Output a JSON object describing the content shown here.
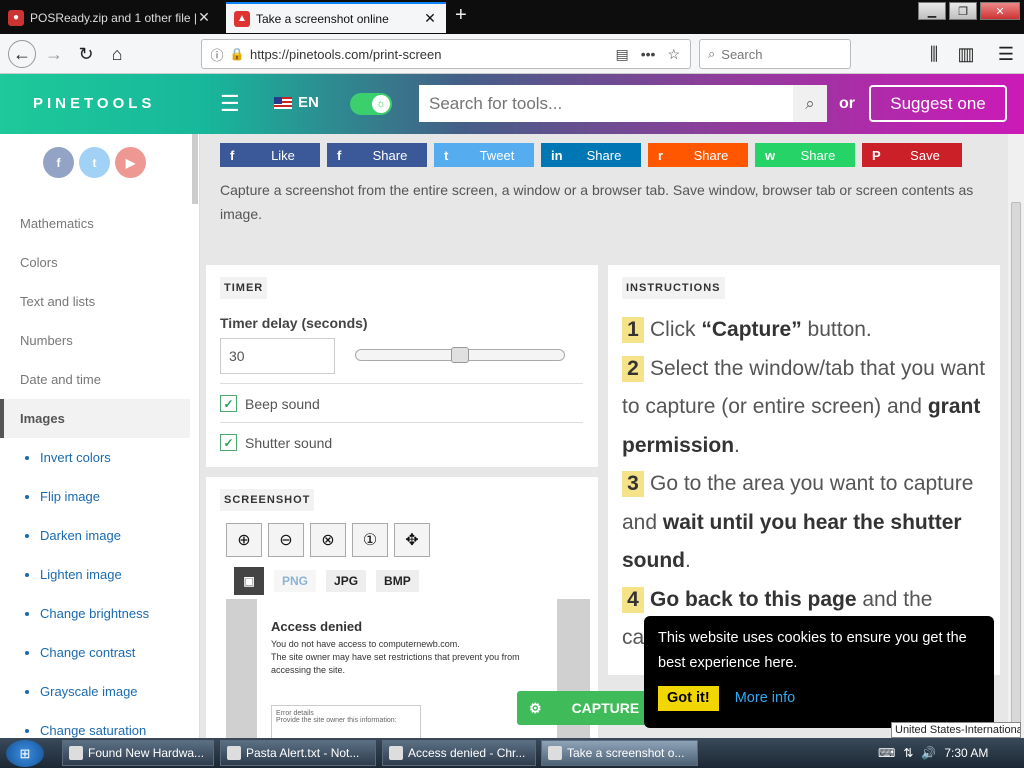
{
  "browser": {
    "tabs": [
      {
        "title": "POSReady.zip and 1 other file |",
        "active": false
      },
      {
        "title": "Take a screenshot online",
        "active": true
      }
    ],
    "url": "https://pinetools.com/print-screen",
    "search_placeholder": "Search"
  },
  "header": {
    "logo": "PINETOOLS",
    "lang": "EN",
    "search_placeholder": "Search for tools...",
    "or": "or",
    "suggest": "Suggest one"
  },
  "sidebar": {
    "social": [
      "f",
      "t",
      "▶"
    ],
    "categories": [
      "Mathematics",
      "Colors",
      "Text and lists",
      "Numbers",
      "Date and time",
      "Images"
    ],
    "active": "Images",
    "subitems": [
      "Invert colors",
      "Flip image",
      "Darken image",
      "Lighten image",
      "Change brightness",
      "Change contrast",
      "Grayscale image",
      "Change saturation"
    ]
  },
  "shares": [
    {
      "icon": "f",
      "label": "Like",
      "color": "#3b5998"
    },
    {
      "icon": "f",
      "label": "Share",
      "color": "#3b5998"
    },
    {
      "icon": "t",
      "label": "Tweet",
      "color": "#55acee"
    },
    {
      "icon": "in",
      "label": "Share",
      "color": "#0077b5"
    },
    {
      "icon": "r",
      "label": "Share",
      "color": "#ff5700"
    },
    {
      "icon": "w",
      "label": "Share",
      "color": "#25d366"
    },
    {
      "icon": "P",
      "label": "Save",
      "color": "#cb2027"
    }
  ],
  "description": "Capture a screenshot from the entire screen, a window or a browser tab. Save window, browser tab or screen contents as image.",
  "timer": {
    "tag": "TIMER",
    "label": "Timer delay (seconds)",
    "value": "30",
    "slider_fraction": 0.5,
    "beep": "Beep sound",
    "shutter": "Shutter sound"
  },
  "screenshot": {
    "tag": "SCREENSHOT",
    "formats": [
      "PNG",
      "JPG",
      "BMP"
    ],
    "preview_title": "Access denied",
    "preview_line1": "You do not have access to computernewb.com.",
    "preview_line2": "The site owner may have set restrictions that prevent you from accessing the site.",
    "preview_details": "Error details",
    "preview_provide": "Provide the site owner this information:"
  },
  "instructions": {
    "tag": "INSTRUCTIONS",
    "step1_pre": "Click ",
    "step1_bold": "“Capture”",
    "step1_post": " button.",
    "step2_pre": "Select the window/tab that you want to capture (or entire screen) and ",
    "step2_bold": "grant permission",
    "step2_post": ".",
    "step3_pre": "Go to the area you want to capture and ",
    "step3_bold": "wait until you hear the shutter sound",
    "step3_post": ".",
    "step4_bold": "Go back to this page",
    "step4_post": " and the",
    "step4_cont": "capture..."
  },
  "capture_label": "CAPTURE",
  "cookie": {
    "text": "This website uses cookies to ensure you get the best experience here.",
    "got": "Got it!",
    "more": "More info"
  },
  "tooltip": "United States-International",
  "taskbar": {
    "tasks": [
      "Found New Hardwa...",
      "Pasta Alert.txt - Not...",
      "Access denied - Chr...",
      "Take a screenshot o..."
    ],
    "time": "7:30 AM"
  }
}
